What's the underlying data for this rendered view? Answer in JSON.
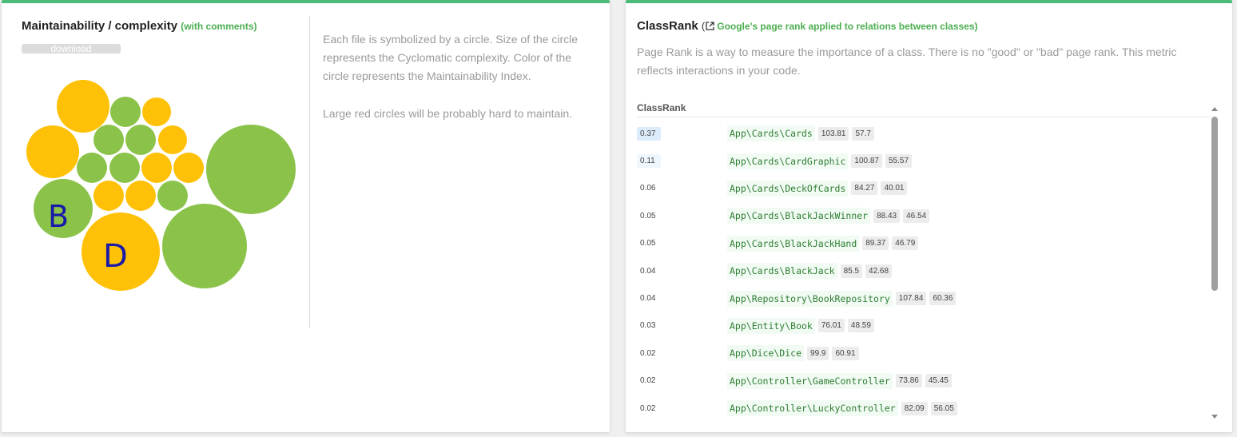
{
  "left": {
    "title": "Maintainability / complexity",
    "subtitle": "(with comments)",
    "download_label": "download",
    "description_1": "Each file is symbolized by a circle. Size of the circle represents the Cyclomatic complexity. Color of the circle represents the Maintainability Index.",
    "description_2": "Large red circles will be probably hard to maintain.",
    "colors": {
      "green": "#8bc34a",
      "yellow": "#ffc107",
      "annotation": "#1a1aa8"
    },
    "annotation_letters": [
      "B",
      "D"
    ]
  },
  "right": {
    "title": "ClassRank",
    "paren_open": "(",
    "link_text": "Google's page rank applied to relations between classes)",
    "description": "Page Rank is a way to measure the importance of a class. There is no \"good\" or \"bad\" page rank. This metric reflects interactions in your code.",
    "table_header": "ClassRank",
    "rows": [
      {
        "rank": "0.37",
        "name": "App\\Cards\\Cards",
        "a": "103.81",
        "b": "57.7"
      },
      {
        "rank": "0.11",
        "name": "App\\Cards\\CardGraphic",
        "a": "100.87",
        "b": "55.57"
      },
      {
        "rank": "0.06",
        "name": "App\\Cards\\DeckOfCards",
        "a": "84.27",
        "b": "40.01"
      },
      {
        "rank": "0.05",
        "name": "App\\Cards\\BlackJackWinner",
        "a": "88.43",
        "b": "46.54"
      },
      {
        "rank": "0.05",
        "name": "App\\Cards\\BlackJackHand",
        "a": "89.37",
        "b": "46.79"
      },
      {
        "rank": "0.04",
        "name": "App\\Cards\\BlackJack",
        "a": "85.5",
        "b": "42.68"
      },
      {
        "rank": "0.04",
        "name": "App\\Repository\\BookRepository",
        "a": "107.84",
        "b": "60.36"
      },
      {
        "rank": "0.03",
        "name": "App\\Entity\\Book",
        "a": "76.01",
        "b": "48.59"
      },
      {
        "rank": "0.02",
        "name": "App\\Dice\\Dice",
        "a": "99.9",
        "b": "60.91"
      },
      {
        "rank": "0.02",
        "name": "App\\Controller\\GameController",
        "a": "73.86",
        "b": "45.45"
      },
      {
        "rank": "0.02",
        "name": "App\\Controller\\LuckyController",
        "a": "82.09",
        "b": "56.05"
      }
    ]
  }
}
